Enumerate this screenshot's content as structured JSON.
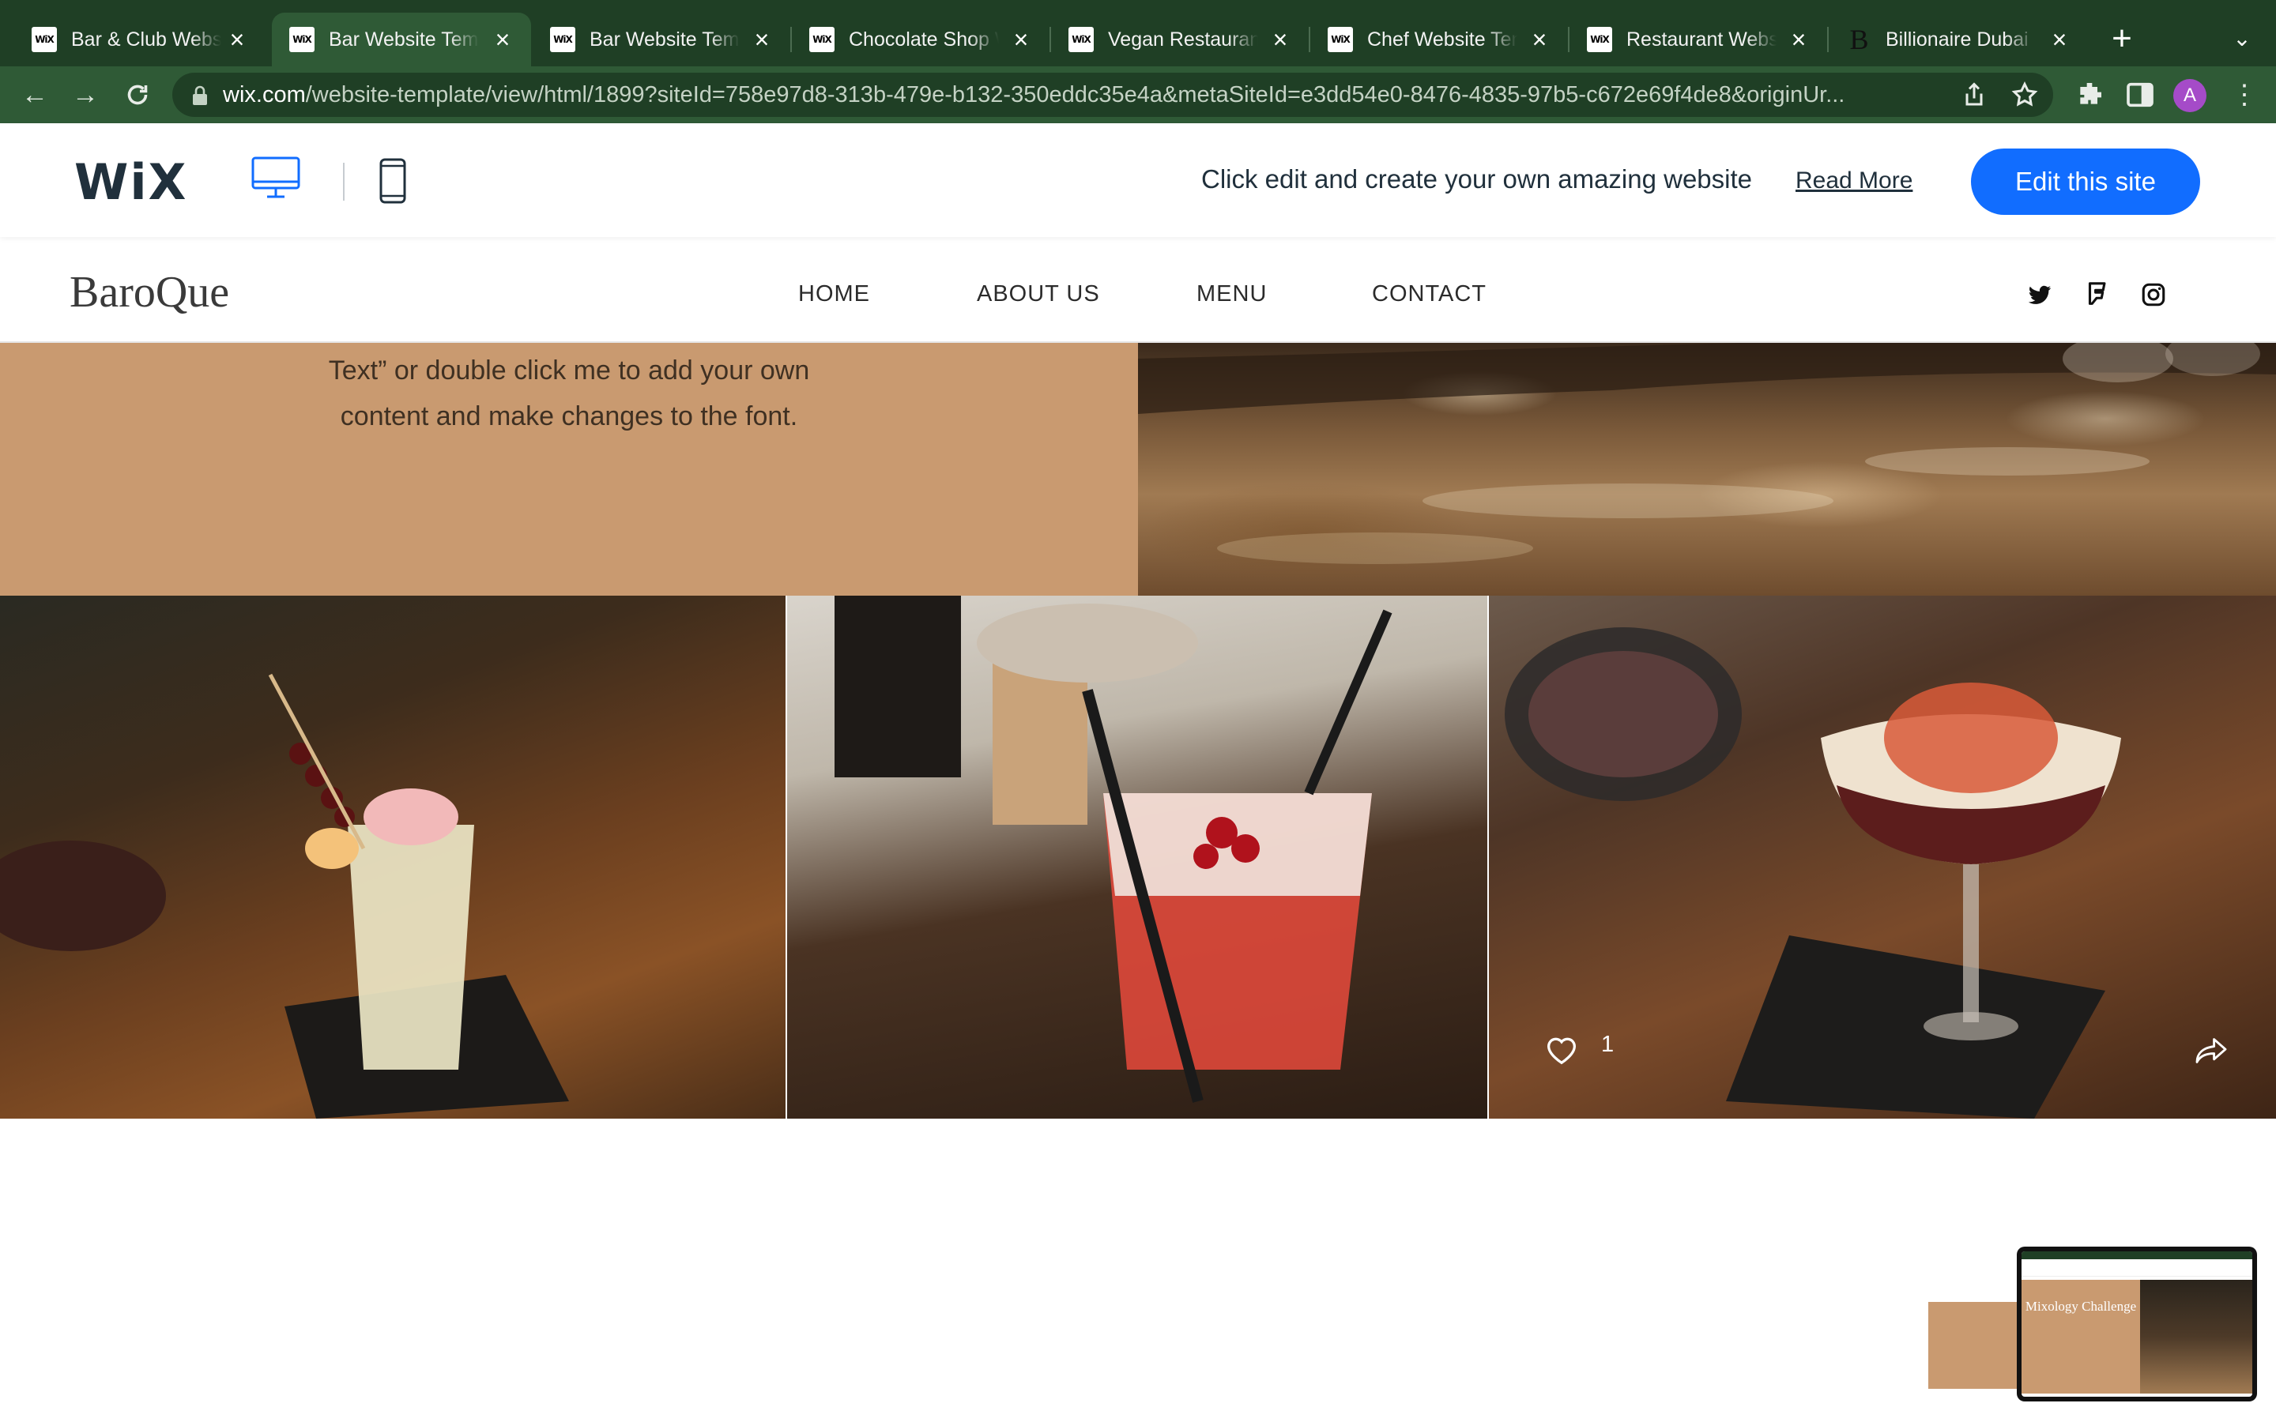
{
  "browser": {
    "tabs": [
      {
        "title": "Bar & Club Websi",
        "favicon": "WiX"
      },
      {
        "title": "Bar Website Temp",
        "favicon": "WiX"
      },
      {
        "title": "Bar Website Temp",
        "favicon": "WiX"
      },
      {
        "title": "Chocolate Shop W",
        "favicon": "WiX"
      },
      {
        "title": "Vegan Restaurant",
        "favicon": "WiX"
      },
      {
        "title": "Chef Website Ten",
        "favicon": "WiX"
      },
      {
        "title": "Restaurant Websi",
        "favicon": "WiX"
      },
      {
        "title": "Billionaire Dubai |",
        "favicon": "B"
      }
    ],
    "active_tab": 1,
    "url_host": "wix.com",
    "url_path": "/website-template/view/html/1899?siteId=758e97d8-313b-479e-b132-350eddc35e4a&metaSiteId=e3dd54e0-8476-4835-97b5-c672e69f4de8&originUr...",
    "profile_initial": "A",
    "colors": {
      "tabbar": "#1f3f25",
      "toolbar": "#2f5a36"
    }
  },
  "wix_bar": {
    "logo": "WiX",
    "promo_text": "Click edit and create your own amazing website",
    "read_more": "Read More",
    "edit_button": "Edit this site",
    "accent": "#116dff"
  },
  "site": {
    "brand": "BaroQue",
    "nav": [
      "HOME",
      "ABOUT US",
      "MENU",
      "CONTACT"
    ],
    "social_icons": [
      "twitter-icon",
      "foursquare-icon",
      "instagram-icon"
    ],
    "body_text_line1": "Text” or double click me to add your own",
    "body_text_line2": "content and make changes to the font.",
    "accent_tan": "#c99a70",
    "gallery": {
      "likes": "1"
    },
    "preview_thumbnail_title": "Mixology Challenge"
  }
}
